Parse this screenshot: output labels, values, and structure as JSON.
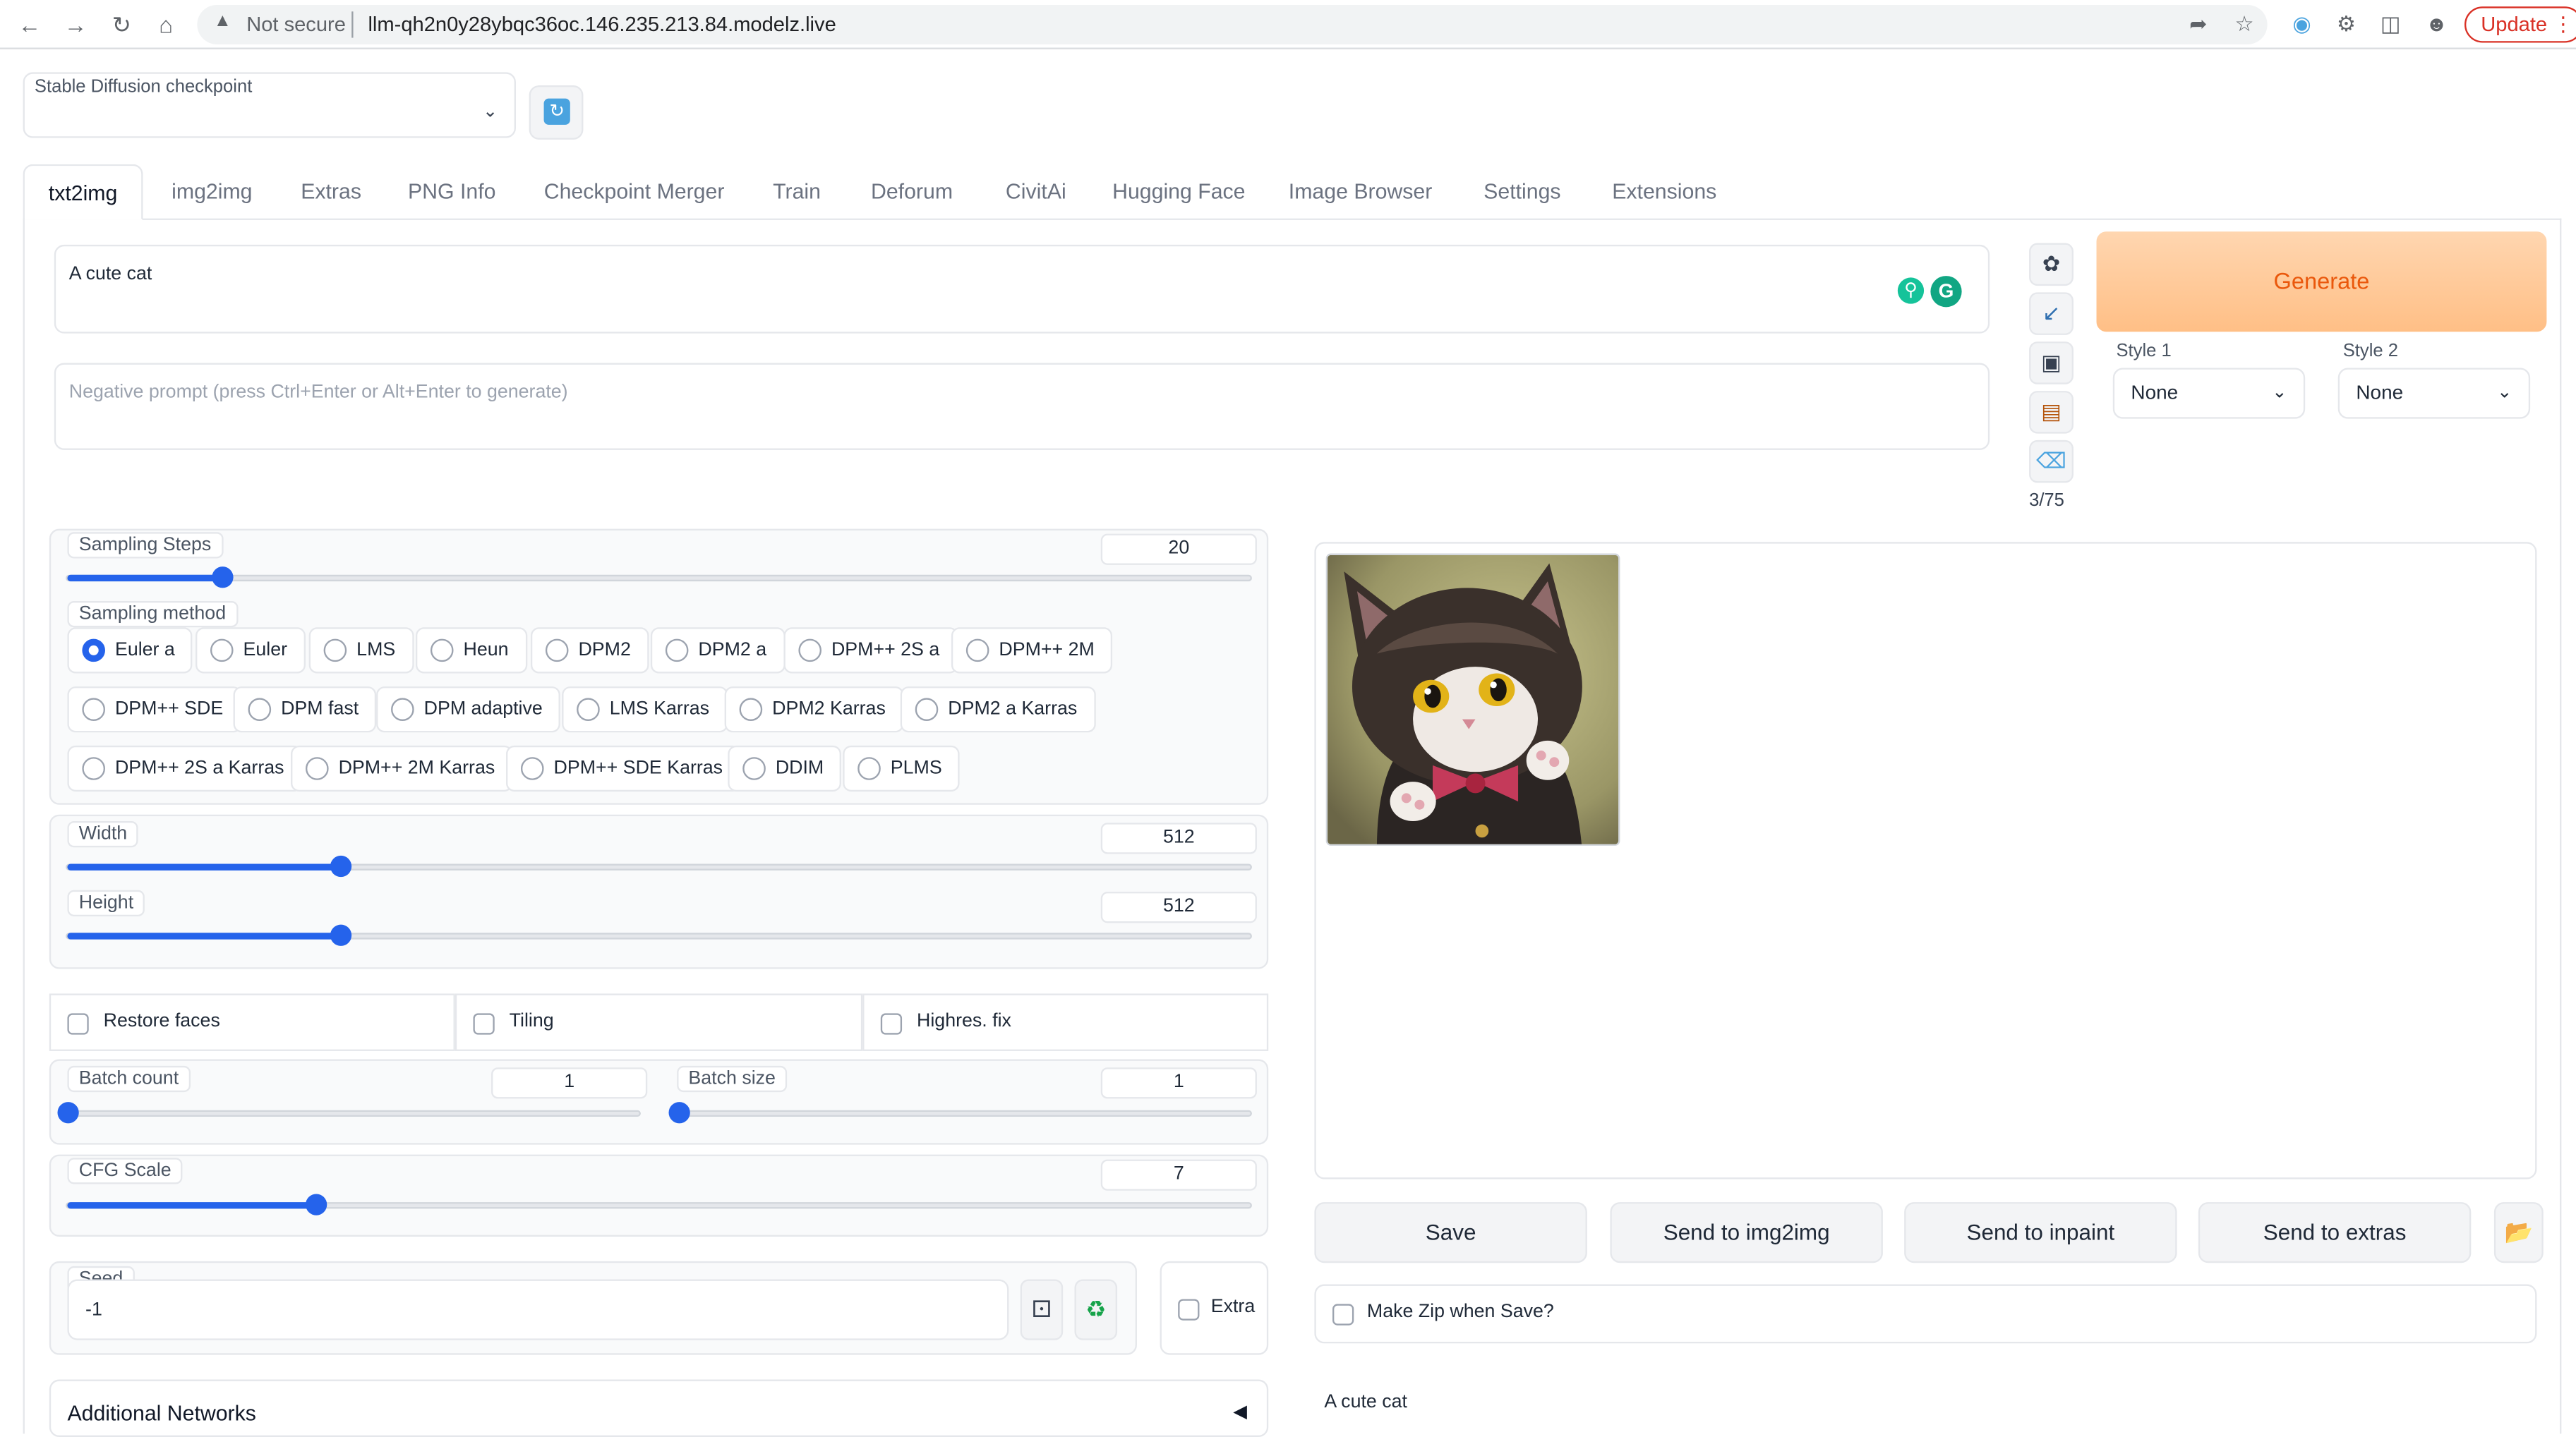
{
  "browser": {
    "security": "Not secure",
    "url": "llm-qh2n0y28ybqc36oc.146.235.213.84.modelz.live",
    "update_label": "Update"
  },
  "checkpoint": {
    "label": "Stable Diffusion checkpoint",
    "value": ""
  },
  "tabs": [
    "txt2img",
    "img2img",
    "Extras",
    "PNG Info",
    "Checkpoint Merger",
    "Train",
    "Deforum",
    "CivitAi",
    "Hugging Face",
    "Image Browser",
    "Settings",
    "Extensions"
  ],
  "prompt": {
    "value": "A cute cat"
  },
  "negative_prompt": {
    "placeholder": "Negative prompt (press Ctrl+Enter or Alt+Enter to generate)"
  },
  "token_count": "3/75",
  "generate": {
    "label": "Generate",
    "colors": {
      "text": "#ea580c",
      "bg": "#ffc88f"
    }
  },
  "styles": [
    {
      "label": "Style 1",
      "value": "None"
    },
    {
      "label": "Style 2",
      "value": "None"
    }
  ],
  "sampling_steps": {
    "label": "Sampling Steps",
    "value": "20",
    "fraction": 0.13
  },
  "sampling_method": {
    "label": "Sampling method",
    "selected": "Euler a",
    "options": [
      "Euler a",
      "Euler",
      "LMS",
      "Heun",
      "DPM2",
      "DPM2 a",
      "DPM++ 2S a",
      "DPM++ 2M",
      "DPM++ SDE",
      "DPM fast",
      "DPM adaptive",
      "LMS Karras",
      "DPM2 Karras",
      "DPM2 a Karras",
      "DPM++ 2S a Karras",
      "DPM++ 2M Karras",
      "DPM++ SDE Karras",
      "DDIM",
      "PLMS"
    ]
  },
  "width": {
    "label": "Width",
    "value": "512",
    "fraction": 0.23
  },
  "height": {
    "label": "Height",
    "value": "512",
    "fraction": 0.23
  },
  "checkboxes": {
    "restore_faces": "Restore faces",
    "tiling": "Tiling",
    "highres_fix": "Highres. fix"
  },
  "batch_count": {
    "label": "Batch count",
    "value": "1",
    "fraction": 0.0
  },
  "batch_size": {
    "label": "Batch size",
    "value": "1",
    "fraction": 0.0
  },
  "cfg_scale": {
    "label": "CFG Scale",
    "value": "7",
    "fraction": 0.21
  },
  "seed": {
    "label": "Seed",
    "value": "-1",
    "extra_label": "Extra"
  },
  "additional_networks": {
    "label": "Additional Networks",
    "toggle": "◀"
  },
  "actions": [
    "Save",
    "Send to img2img",
    "Send to inpaint",
    "Send to extras"
  ],
  "make_zip": "Make Zip when Save?",
  "output_info": {
    "prompt": "A cute cat"
  },
  "accent_color": "#2563eb",
  "icons": {
    "back": "arrow-left-icon",
    "forward": "arrow-right-icon",
    "reload": "reload-icon",
    "home": "home-icon",
    "refresh": "refresh-icon",
    "palette": "palette-icon",
    "arrow": "arrow-icon",
    "save": "floppy-disk-icon",
    "clipboard": "clipboard-icon",
    "trash": "trash-icon",
    "dice": "dice-icon",
    "recycle": "recycle-icon",
    "folder": "folder-icon"
  }
}
